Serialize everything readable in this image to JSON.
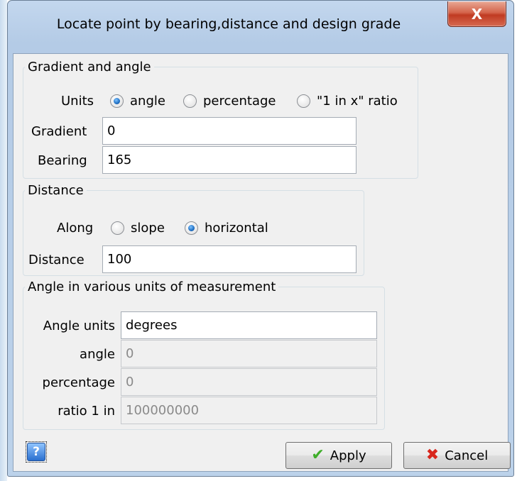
{
  "window": {
    "title": "Locate point by bearing,distance and design grade",
    "close_glyph": "X"
  },
  "gradient_group": {
    "legend": "Gradient and angle",
    "units_label": "Units",
    "units_options": [
      {
        "label": "angle",
        "selected": true
      },
      {
        "label": "percentage",
        "selected": false
      },
      {
        "label": "\"1 in x\" ratio",
        "selected": false
      }
    ],
    "gradient_label": "Gradient",
    "gradient_value": "0",
    "bearing_label": "Bearing",
    "bearing_value": "165"
  },
  "distance_group": {
    "legend": "Distance",
    "along_label": "Along",
    "along_options": [
      {
        "label": "slope",
        "selected": false
      },
      {
        "label": "horizontal",
        "selected": true
      }
    ],
    "distance_label": "Distance",
    "distance_value": "100"
  },
  "angle_group": {
    "legend": "Angle in various units of measurement",
    "angle_units_label": "Angle units",
    "angle_units_value": "degrees",
    "angle_label": "angle",
    "angle_value": "0",
    "percentage_label": "percentage",
    "percentage_value": "0",
    "ratio_label": "ratio 1 in",
    "ratio_value": "100000000"
  },
  "buttons": {
    "help_glyph": "?",
    "apply_label": "Apply",
    "cancel_label": "Cancel"
  },
  "icons": {
    "apply": "checkmark-icon",
    "cancel": "x-icon",
    "help": "question-icon"
  },
  "colors": {
    "apply_check": "#3fae2a",
    "cancel_x": "#d8261c",
    "radio_selected": "#1f6fc3"
  }
}
